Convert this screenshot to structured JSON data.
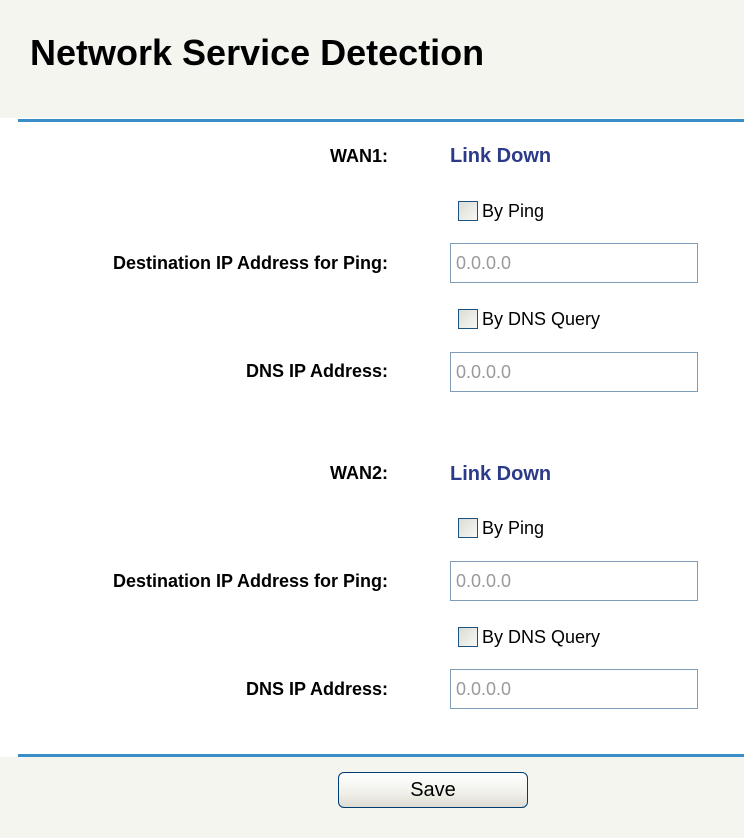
{
  "page": {
    "title": "Network Service Detection"
  },
  "wan1": {
    "label": "WAN1:",
    "status": "Link Down",
    "by_ping_label": "By Ping",
    "ping_ip_label": "Destination IP Address for Ping:",
    "ping_ip_value": "0.0.0.0",
    "by_dns_label": "By DNS Query",
    "dns_ip_label": "DNS IP Address:",
    "dns_ip_value": "0.0.0.0"
  },
  "wan2": {
    "label": "WAN2:",
    "status": "Link Down",
    "by_ping_label": "By Ping",
    "ping_ip_label": "Destination IP Address for Ping:",
    "ping_ip_value": "0.0.0.0",
    "by_dns_label": "By DNS Query",
    "dns_ip_label": "DNS IP Address:",
    "dns_ip_value": "0.0.0.0"
  },
  "actions": {
    "save_label": "Save"
  },
  "colors": {
    "accent_line": "#3a8ec8",
    "status_text": "#2c3a8a",
    "band_background": "#f5f5f0",
    "input_border": "#7f9db9"
  }
}
